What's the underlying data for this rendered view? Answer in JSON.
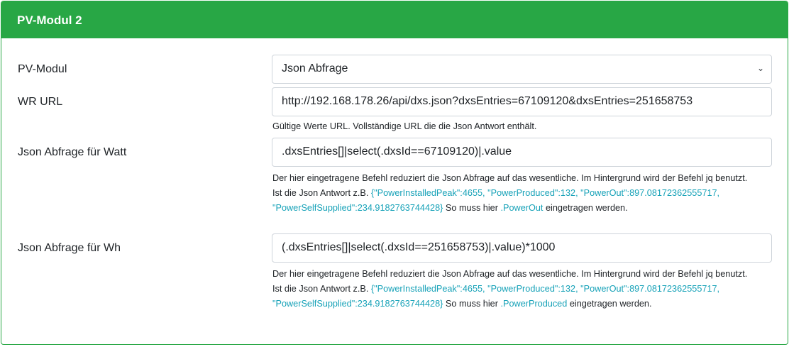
{
  "card": {
    "title": "PV-Modul 2",
    "accent": "#28a745"
  },
  "fields": {
    "pv_modul": {
      "label": "PV-Modul",
      "value": "Json Abfrage"
    },
    "wr_url": {
      "label": "WR URL",
      "value": "http://192.168.178.26/api/dxs.json?dxsEntries=67109120&dxsEntries=251658753",
      "help": "Gültige Werte URL. Vollständige URL die die Json Antwort enthält."
    },
    "json_watt": {
      "label": "Json Abfrage für Watt",
      "value": ".dxsEntries[]|select(.dxsId==67109120)|.value",
      "help1": "Der hier eingetragene Befehl reduziert die Json Abfrage auf das wesentliche. Im Hintergrund wird der Befehl jq benutzt.",
      "help2_prefix": "Ist die Json Antwort z.B. ",
      "help2_example": "{\"PowerInstalledPeak\":4655, \"PowerProduced\":132, \"PowerOut\":897.08172362555717, \"PowerSelfSupplied\":234.9182763744428}",
      "help2_mid": " So muss hier ",
      "help2_key": ".PowerOut",
      "help2_suffix": " eingetragen werden."
    },
    "json_wh": {
      "label": "Json Abfrage für Wh",
      "value": "(.dxsEntries[]|select(.dxsId==251658753)|.value)*1000",
      "help1": "Der hier eingetragene Befehl reduziert die Json Abfrage auf das wesentliche. Im Hintergrund wird der Befehl jq benutzt.",
      "help2_prefix": "Ist die Json Antwort z.B. ",
      "help2_example": "{\"PowerInstalledPeak\":4655, \"PowerProduced\":132, \"PowerOut\":897.08172362555717, \"PowerSelfSupplied\":234.9182763744428}",
      "help2_mid": " So muss hier ",
      "help2_key": ".PowerProduced",
      "help2_suffix": " eingetragen werden."
    }
  }
}
